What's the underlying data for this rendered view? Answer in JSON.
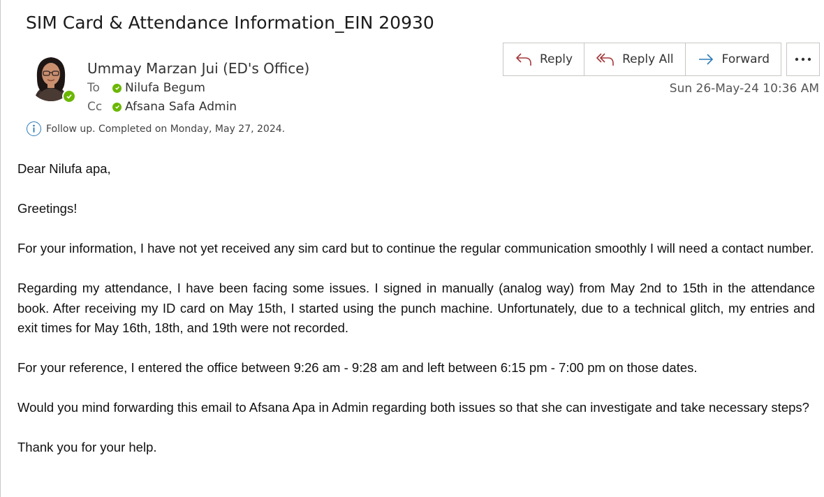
{
  "email": {
    "subject": "SIM Card & Attendance Information_EIN 20930",
    "sender": "Ummay Marzan Jui (ED's Office)",
    "to_label": "To",
    "to_name": "Nilufa Begum",
    "cc_label": "Cc",
    "cc_name": "Afsana Safa Admin",
    "followup_text": "Follow up.  Completed on Monday, May 27, 2024.",
    "date": "Sun 26-May-24 10:36 AM"
  },
  "actions": {
    "reply_label": "Reply",
    "reply_all_label": "Reply All",
    "forward_label": "Forward"
  },
  "body": {
    "paragraphs": [
      "Dear Nilufa apa,",
      "Greetings!",
      "For your information, I have not yet received any sim card but to continue the regular communication smoothly I will need a contact number.",
      "Regarding my attendance, I have been facing some issues. I signed in manually (analog way) from May 2nd to 15th in the attendance book. After receiving my ID card on May 15th, I started using the punch machine. Unfortunately, due to a technical glitch, my entries and exit times for May 16th, 18th, and 19th were not recorded.",
      "For your reference, I entered the office between 9:26 am - 9:28 am and left between 6:15 pm - 7:00 pm on those dates.",
      "Would you mind forwarding this email to Afsana Apa in Admin regarding both issues so that she can investigate and take necessary steps?",
      "Thank you for your help."
    ]
  },
  "colors": {
    "presence_green": "#6bb700",
    "reply_icon": "#a4373a",
    "forward_icon": "#2a7ab8",
    "info_icon": "#2a7ab8"
  },
  "icons": {
    "reply": "reply-icon",
    "reply_all": "reply-all-icon",
    "forward": "forward-icon",
    "more": "more-icon",
    "info": "info-icon",
    "presence": "presence-available-icon"
  }
}
